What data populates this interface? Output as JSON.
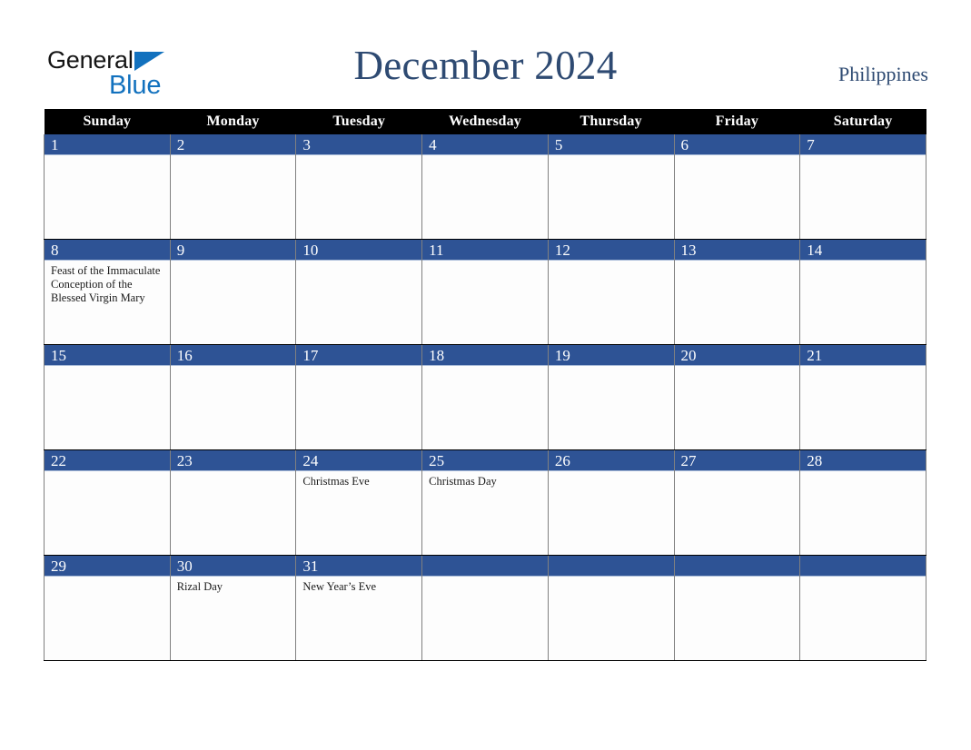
{
  "logo": {
    "word_black": "General",
    "word_blue": "Blue",
    "triangle_color": "#1271BE",
    "black_color": "#141414"
  },
  "header": {
    "title": "December 2024",
    "locale": "Philippines",
    "title_color": "#2E4A72"
  },
  "colors": {
    "weekday_header_bg": "#000000",
    "weekday_header_text": "#FFFFFF",
    "daynum_band": "#2E5395",
    "daynum_text": "#FFFFFF",
    "cell_bg": "#FDFDFD",
    "grid_line": "#000000"
  },
  "weekdays": [
    "Sunday",
    "Monday",
    "Tuesday",
    "Wednesday",
    "Thursday",
    "Friday",
    "Saturday"
  ],
  "weeks": [
    [
      {
        "day": "1",
        "events": []
      },
      {
        "day": "2",
        "events": []
      },
      {
        "day": "3",
        "events": []
      },
      {
        "day": "4",
        "events": []
      },
      {
        "day": "5",
        "events": []
      },
      {
        "day": "6",
        "events": []
      },
      {
        "day": "7",
        "events": []
      }
    ],
    [
      {
        "day": "8",
        "events": [
          "Feast of the Immaculate Conception of the Blessed Virgin Mary"
        ]
      },
      {
        "day": "9",
        "events": []
      },
      {
        "day": "10",
        "events": []
      },
      {
        "day": "11",
        "events": []
      },
      {
        "day": "12",
        "events": []
      },
      {
        "day": "13",
        "events": []
      },
      {
        "day": "14",
        "events": []
      }
    ],
    [
      {
        "day": "15",
        "events": []
      },
      {
        "day": "16",
        "events": []
      },
      {
        "day": "17",
        "events": []
      },
      {
        "day": "18",
        "events": []
      },
      {
        "day": "19",
        "events": []
      },
      {
        "day": "20",
        "events": []
      },
      {
        "day": "21",
        "events": []
      }
    ],
    [
      {
        "day": "22",
        "events": []
      },
      {
        "day": "23",
        "events": []
      },
      {
        "day": "24",
        "events": [
          "Christmas Eve"
        ]
      },
      {
        "day": "25",
        "events": [
          "Christmas Day"
        ]
      },
      {
        "day": "26",
        "events": []
      },
      {
        "day": "27",
        "events": []
      },
      {
        "day": "28",
        "events": []
      }
    ],
    [
      {
        "day": "29",
        "events": []
      },
      {
        "day": "30",
        "events": [
          "Rizal Day"
        ]
      },
      {
        "day": "31",
        "events": [
          "New Year’s Eve"
        ]
      },
      {
        "day": "",
        "events": []
      },
      {
        "day": "",
        "events": []
      },
      {
        "day": "",
        "events": []
      },
      {
        "day": "",
        "events": []
      }
    ]
  ]
}
